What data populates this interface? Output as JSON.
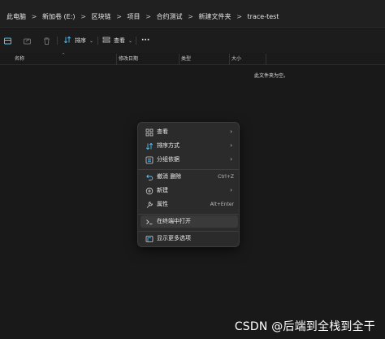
{
  "breadcrumb": {
    "items": [
      "此电脑",
      "新加卷 (E:)",
      "区块链",
      "项目",
      "合约测试",
      "新建文件夹",
      "trace-test"
    ],
    "separator": ">"
  },
  "toolbar": {
    "sort_label": "排序",
    "view_label": "查看",
    "more_label": "···",
    "icons": [
      "new-item-icon",
      "share-icon",
      "delete-icon",
      "sort-icon",
      "view-icon",
      "more-icon"
    ]
  },
  "columns": {
    "name": "名称",
    "modified": "修改日期",
    "type": "类型",
    "size": "大小"
  },
  "empty_message": "此文件夹为空。",
  "context_menu": {
    "items": [
      {
        "label": "查看",
        "icon": "view-grid-icon",
        "submenu": true
      },
      {
        "label": "排序方式",
        "icon": "sort-icon",
        "submenu": true
      },
      {
        "label": "分组依据",
        "icon": "group-icon",
        "submenu": true
      },
      {
        "label": "撤消 删除",
        "icon": "undo-icon",
        "shortcut": "Ctrl+Z"
      },
      {
        "label": "新建",
        "icon": "new-icon",
        "submenu": true
      },
      {
        "label": "属性",
        "icon": "properties-icon",
        "shortcut": "Alt+Enter"
      },
      {
        "label": "在终端中打开",
        "icon": "terminal-icon",
        "highlighted": true
      },
      {
        "label": "显示更多选项",
        "icon": "more-options-icon"
      }
    ],
    "submenu_arrow": "›"
  },
  "watermark": "CSDN @后端到全栈到全干",
  "colors": {
    "background": "#191919",
    "menu_bg": "#2b2b2b",
    "accent": "#4cc2ff",
    "text": "#e8e8e8"
  }
}
